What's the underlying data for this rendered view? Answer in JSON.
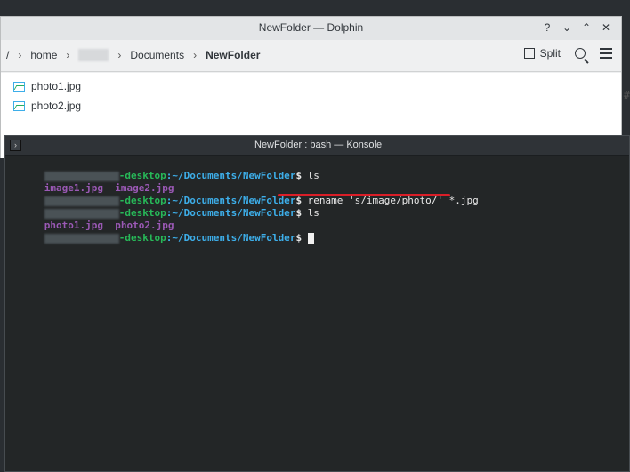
{
  "dolphin": {
    "title": "NewFolder — Dolphin",
    "controls": [
      "?",
      "⌄",
      "⌃",
      "✕"
    ],
    "breadcrumb": {
      "root": "/",
      "items": [
        "home",
        "Documents",
        "NewFolder"
      ]
    },
    "toolbar": {
      "split_label": "Split"
    },
    "files": [
      "photo1.jpg",
      "photo2.jpg"
    ]
  },
  "side_text": "#",
  "konsole": {
    "title": "NewFolder : bash — Konsole",
    "host_suffix": "-desktop",
    "path": ":~/Documents/NewFolder",
    "dollar": "$",
    "lines": {
      "cmd1": " ls",
      "out1_a": "image1.jpg",
      "out1_b": "  image2.jpg",
      "cmd2": " rename 's/image/photo/' *.jpg",
      "cmd3": " ls",
      "out2_a": "photo1.jpg",
      "out2_b": "  photo2.jpg"
    }
  }
}
